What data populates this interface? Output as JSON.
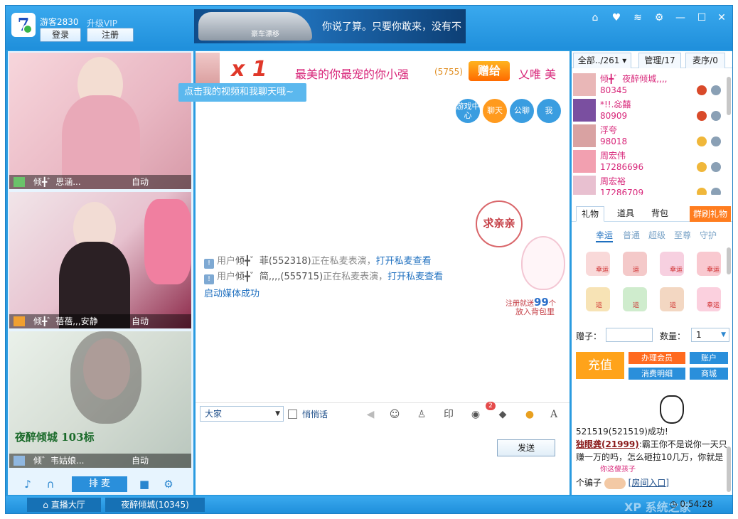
{
  "window": {
    "logo_text": "7",
    "guest_label": "游客2830",
    "upgrade_vip": "升级VIP",
    "login": "登录",
    "register": "注册"
  },
  "banner": {
    "brand": "豪车漂移",
    "text": "你说了算。只要你敢来，没有不"
  },
  "videos": [
    {
      "name": "倾╋゛思涵...",
      "mode": "自动"
    },
    {
      "name": "倾╋゛蓓蓓,,,安静",
      "mode": "自动"
    },
    {
      "name": "倾゛韦姑娘...",
      "mode": "自动",
      "overlay": "夜醉倾城 103标"
    }
  ],
  "left_controls": {
    "queue_mic": "排 麦"
  },
  "ticker": {
    "count": "x 1",
    "message": "最美的你最宠的你小强",
    "number": "(5755)",
    "gift_word": "赠给",
    "recipient": "乂唯 美"
  },
  "tooltip": "点击我的视频和我聊天哦~",
  "chat_tabs": [
    "游戏中心",
    "聊天",
    "公聊",
    "我"
  ],
  "messages": [
    {
      "prefix": "用户",
      "user": "倾╋゛菲(552318)",
      "text": "正在私麦表演，",
      "link": "打开私麦查看"
    },
    {
      "prefix": "用户",
      "user": "倾╋゛简,,,,(555715)",
      "text": "正在私麦表演，",
      "link": "打开私麦查看"
    }
  ],
  "media_status": "启动媒体成功",
  "promo": {
    "bubble": "求亲亲",
    "register_prefix": "注册就送",
    "register_count": "99",
    "register_suffix": "个",
    "bag": "放入背包里"
  },
  "input": {
    "target": "大家",
    "whisper_label": "悄悄话",
    "badge_count": "2",
    "send": "发送"
  },
  "user_tabs": [
    "全部../261",
    "管理/17",
    "麦序/0"
  ],
  "users": [
    {
      "name": "倾╋゛夜醉倾城,,,,",
      "id": "80345"
    },
    {
      "name": "*!!.惢囍",
      "id": "80909"
    },
    {
      "name": "浮夸",
      "id": "98018"
    },
    {
      "name": "周宏伟",
      "id": "17286696"
    },
    {
      "name": "周宏裕",
      "id": "17286709"
    }
  ],
  "gift_tabs": [
    "礼物",
    "道具",
    "背包"
  ],
  "gift_broadcast": "群刷礼物",
  "gift_subtabs": [
    "幸运",
    "普通",
    "超级",
    "至尊",
    "守护"
  ],
  "gift_tags": [
    "幸运",
    "运",
    "幸运",
    "幸运",
    "运",
    "运",
    "运",
    "幸运"
  ],
  "gift_form": {
    "to_label": "赠子：",
    "qty_label": "数量：",
    "qty_value": "1"
  },
  "account_buttons": {
    "recharge": "充值",
    "member": "办理会员",
    "account": "账户",
    "spending": "消费明细",
    "shop": "商城"
  },
  "feed": {
    "line1": "521519(521519)成功!",
    "user": "独眼龚(21999)",
    "line2": ":霸王你不是说你一天只赚一万的吗，怎么砸拉10几万，你就是",
    "pink": "你这傻孩子",
    "line3": "个骗子",
    "room_entry": "[房间入口]"
  },
  "statusbar": {
    "lobby": "直播大厅",
    "room": "夜醉倾城(10345)",
    "timer": "0:54:28",
    "watermark": "XP 系统之家"
  },
  "colors": {
    "primary": "#2a9be0",
    "accent_orange": "#ff9a1e",
    "pink_text": "#d8277a",
    "link_blue": "#1e6fbf"
  }
}
